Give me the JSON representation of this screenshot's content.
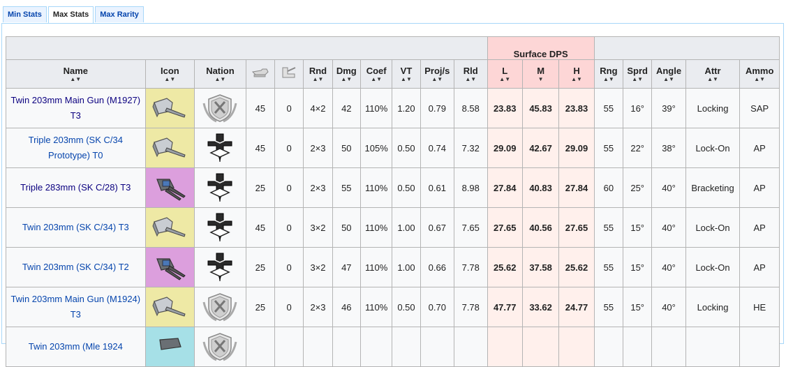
{
  "tabs": [
    {
      "label": "Min Stats",
      "active": false
    },
    {
      "label": "Max Stats",
      "active": true
    },
    {
      "label": "Max Rarity",
      "active": false
    }
  ],
  "header": {
    "group_label": "Surface DPS",
    "columns": {
      "name": "Name",
      "icon": "Icon",
      "nation": "Nation",
      "stat1_icon": "firepower-gun-icon",
      "stat2_icon": "aircraft-icon",
      "rnd": "Rnd",
      "dmg": "Dmg",
      "coef": "Coef",
      "vt": "VT",
      "projs": "Proj/s",
      "rld": "Rld",
      "l": "L",
      "m": "M",
      "h": "H",
      "rng": "Rng",
      "sprd": "Sprd",
      "angle": "Angle",
      "attr": "Attr",
      "ammo": "Ammo"
    },
    "sort_markers": {
      "default": "▲▼",
      "desc_active": "▼"
    }
  },
  "rows": [
    {
      "name": "Twin 203mm Main Gun (M1927) T3",
      "rarity_color": "gold",
      "nation_icon": "crest-icon",
      "s1": "45",
      "s2": "0",
      "rnd": "4×2",
      "dmg": "42",
      "coef": "110%",
      "vt": "1.20",
      "projs": "0.79",
      "rld": "8.58",
      "l": "23.83",
      "m": "45.83",
      "h": "23.83",
      "rng": "55",
      "sprd": "16°",
      "angle": "39°",
      "attr": "Locking",
      "ammo": "SAP"
    },
    {
      "name": "Triple 203mm (SK C/34 Prototype) T0",
      "rarity_color": "gold",
      "nation_icon": "iron-cross-icon",
      "s1": "45",
      "s2": "0",
      "rnd": "2×3",
      "dmg": "50",
      "coef": "105%",
      "vt": "0.50",
      "projs": "0.74",
      "rld": "7.32",
      "l": "29.09",
      "m": "42.67",
      "h": "29.09",
      "rng": "55",
      "sprd": "22°",
      "angle": "38°",
      "attr": "Lock-On",
      "ammo": "AP"
    },
    {
      "name": "Triple 283mm (SK C/28) T3",
      "rarity_color": "purple",
      "nation_icon": "iron-cross-icon",
      "s1": "25",
      "s2": "0",
      "rnd": "2×3",
      "dmg": "55",
      "coef": "110%",
      "vt": "0.50",
      "projs": "0.61",
      "rld": "8.98",
      "l": "27.84",
      "m": "40.83",
      "h": "27.84",
      "rng": "60",
      "sprd": "25°",
      "angle": "40°",
      "attr": "Bracketing",
      "ammo": "AP"
    },
    {
      "name": "Twin 203mm (SK C/34) T3",
      "rarity_color": "gold",
      "nation_icon": "iron-cross-icon",
      "s1": "45",
      "s2": "0",
      "rnd": "3×2",
      "dmg": "50",
      "coef": "110%",
      "vt": "1.00",
      "projs": "0.67",
      "rld": "7.65",
      "l": "27.65",
      "m": "40.56",
      "h": "27.65",
      "rng": "55",
      "sprd": "15°",
      "angle": "40°",
      "attr": "Lock-On",
      "ammo": "AP"
    },
    {
      "name": "Twin 203mm (SK C/34) T2",
      "rarity_color": "purple",
      "nation_icon": "iron-cross-icon",
      "s1": "25",
      "s2": "0",
      "rnd": "3×2",
      "dmg": "47",
      "coef": "110%",
      "vt": "1.00",
      "projs": "0.66",
      "rld": "7.78",
      "l": "25.62",
      "m": "37.58",
      "h": "25.62",
      "rng": "55",
      "sprd": "15°",
      "angle": "40°",
      "attr": "Lock-On",
      "ammo": "AP"
    },
    {
      "name": "Twin 203mm Main Gun (M1924) T3",
      "rarity_color": "gold",
      "nation_icon": "crest-icon",
      "s1": "25",
      "s2": "0",
      "rnd": "2×3",
      "dmg": "46",
      "coef": "110%",
      "vt": "0.50",
      "projs": "0.70",
      "rld": "7.78",
      "l": "47.77",
      "m": "33.62",
      "h": "24.77",
      "rng": "55",
      "sprd": "15°",
      "angle": "40°",
      "attr": "Locking",
      "ammo": "HE"
    },
    {
      "name": "Twin 203mm (Mle 1924",
      "rarity_color": "teal",
      "nation_icon": "crest-icon",
      "s1": "",
      "s2": "",
      "rnd": "",
      "dmg": "",
      "coef": "",
      "vt": "",
      "projs": "",
      "rld": "",
      "l": "",
      "m": "",
      "h": "",
      "rng": "",
      "sprd": "",
      "angle": "",
      "attr": "",
      "ammo": ""
    }
  ]
}
